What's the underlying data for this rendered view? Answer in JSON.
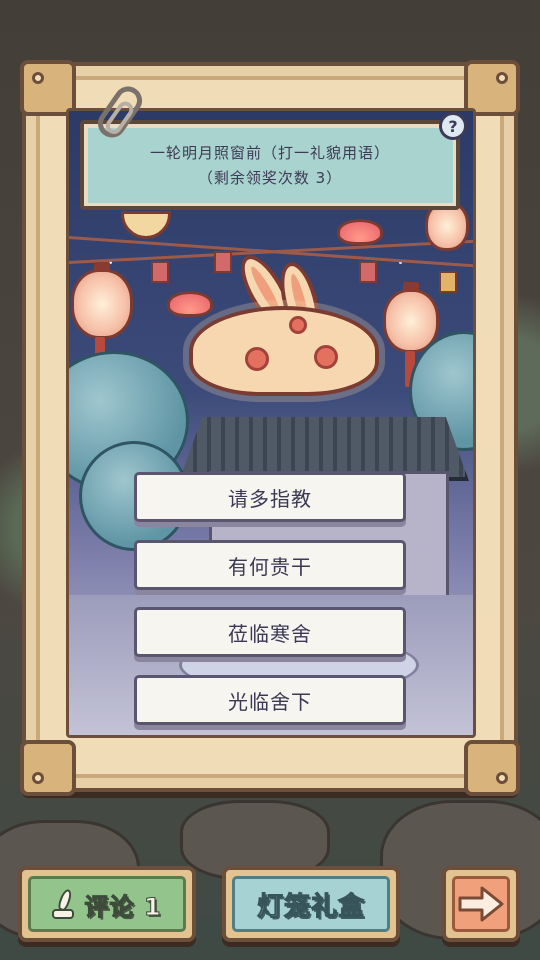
{
  "riddle": {
    "line1": "一轮明月照窗前（打一礼貌用语）",
    "line2": "（剩余领奖次数 3）"
  },
  "help_label": "?",
  "answers": [
    {
      "label": "请多指教"
    },
    {
      "label": "有何贵干"
    },
    {
      "label": "莅临寒舍"
    },
    {
      "label": "光临舍下"
    }
  ],
  "bottom_bar": {
    "comment_label": "评论 1",
    "gift_label": "灯笼礼盒",
    "next_icon": "arrow-right-icon"
  },
  "icons": {
    "paperclip": "paperclip-icon",
    "help": "help-icon",
    "comment": "quill-icon"
  },
  "colors": {
    "riddle_card": "#a9d3cf",
    "comment_button": "#93c48b",
    "gift_button": "#a6d2d4",
    "next_button": "#f0a07a"
  }
}
